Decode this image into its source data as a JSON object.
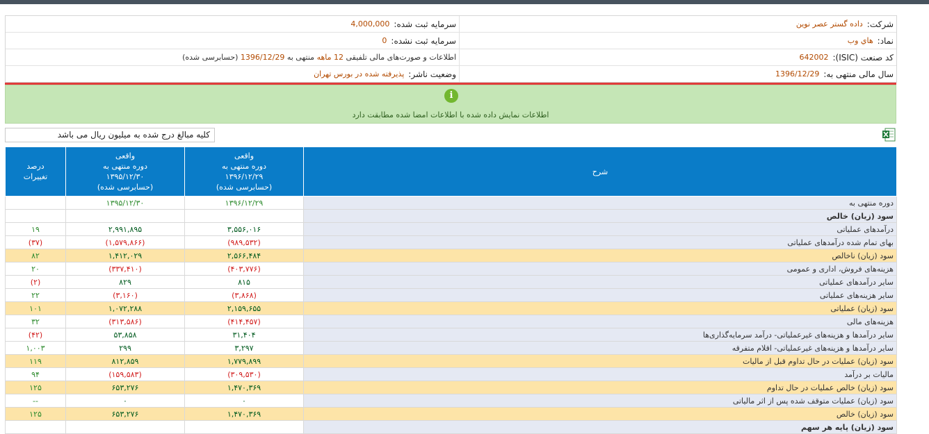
{
  "company": {
    "company_label": "شرکت:",
    "company_value": "داده گستر عصر نوین",
    "capital_reg_label": "سرمایه ثبت شده:",
    "capital_reg_value": "4,000,000",
    "symbol_label": "نماد:",
    "symbol_value": "هاي وب",
    "capital_unreg_label": "سرمایه ثبت نشده:",
    "capital_unreg_value": "0",
    "isic_label": "کد صنعت (ISIC):",
    "isic_value": "642002",
    "report_prefix": "اطلاعات و صورت‌های مالی تلفیقی",
    "report_period": "12 ماهه",
    "report_mid": "منتهی به",
    "report_date": "1396/12/29",
    "report_suffix": "(حسابرسی شده)",
    "fiscal_label": "سال مالی منتهی به:",
    "fiscal_value": "1396/12/29",
    "publisher_label": "وضعیت ناشر:",
    "publisher_value": "پذیرفته شده در بورس تهران"
  },
  "notice": {
    "icon": "info-icon",
    "text": "اطلاعات نمایش داده شده با اطلاعات امضا شده مطابقت دارد"
  },
  "unit_note": "کلیه مبالغ درج شده به میلیون ریال می باشد",
  "table": {
    "headers": {
      "desc": "شرح",
      "col1_l1": "واقعی",
      "col1_l2": "دوره منتهی به",
      "col1_l3": "۱۳۹۶/۱۲/۲۹",
      "col1_l4": "(حسابرسی شده)",
      "col2_l1": "واقعی",
      "col2_l2": "دوره منتهی به",
      "col2_l3": "۱۳۹۵/۱۲/۳۰",
      "col2_l4": "(حسابرسی شده)",
      "pct_l1": "درصد",
      "pct_l2": "تغییرات"
    },
    "rows": [
      {
        "desc": "دوره منتهی به",
        "v1": "۱۳۹۶/۱۲/۲۹",
        "v2": "۱۳۹۵/۱۲/۳۰",
        "pct": ""
      },
      {
        "desc": "سود (زیان) خالص",
        "v1": "",
        "v2": "",
        "pct": ""
      },
      {
        "desc": "درآمدهای عملیاتی",
        "v1": "۳,۵۵۶,۰۱۶",
        "v2": "۲,۹۹۱,۸۹۵",
        "pct": "۱۹"
      },
      {
        "desc": "بهای تمام شده درآمدهای عملیاتی",
        "v1": "(۹۸۹,۵۳۲)",
        "v2": "(۱,۵۷۹,۸۶۶)",
        "pct": "(۳۷)"
      },
      {
        "desc": "سود (زیان) ناخالص",
        "v1": "۲,۵۶۶,۴۸۴",
        "v2": "۱,۴۱۲,۰۲۹",
        "pct": "۸۲"
      },
      {
        "desc": "هزینه‌های فروش، اداری و عمومی",
        "v1": "(۴۰۳,۷۷۶)",
        "v2": "(۳۳۷,۴۱۰)",
        "pct": "۲۰"
      },
      {
        "desc": "سایر درآمدهای عملیاتی",
        "v1": "۸۱۵",
        "v2": "۸۲۹",
        "pct": "(۲)"
      },
      {
        "desc": "سایر هزینه‌های عملیاتی",
        "v1": "(۳,۸۶۸)",
        "v2": "(۳,۱۶۰)",
        "pct": "۲۲"
      },
      {
        "desc": "سود (زیان) عملیاتی",
        "v1": "۲,۱۵۹,۶۵۵",
        "v2": "۱,۰۷۲,۲۸۸",
        "pct": "۱۰۱"
      },
      {
        "desc": "هزینه‌های مالی",
        "v1": "(۴۱۴,۴۵۷)",
        "v2": "(۳۱۳,۵۸۶)",
        "pct": "۳۲"
      },
      {
        "desc": "سایر درآمدها و هزینه‌های غیرعملیاتی- درآمد سرمایه‌گذاری‌ها",
        "v1": "۳۱,۴۰۴",
        "v2": "۵۳,۸۵۸",
        "pct": "(۴۲)"
      },
      {
        "desc": "سایر درآمدها و هزینه‌های غیرعملیاتی- اقلام متفرقه",
        "v1": "۳,۲۹۷",
        "v2": "۲۹۹",
        "pct": "۱,۰۰۳"
      },
      {
        "desc": "سود (زیان) عملیات در حال تداوم قبل از مالیات",
        "v1": "۱,۷۷۹,۸۹۹",
        "v2": "۸۱۲,۸۵۹",
        "pct": "۱۱۹"
      },
      {
        "desc": "مالیات بر درآمد",
        "v1": "(۳۰۹,۵۳۰)",
        "v2": "(۱۵۹,۵۸۳)",
        "pct": "۹۴"
      },
      {
        "desc": "سود (زیان) خالص عملیات در حال تداوم",
        "v1": "۱,۴۷۰,۳۶۹",
        "v2": "۶۵۳,۲۷۶",
        "pct": "۱۲۵"
      },
      {
        "desc": "سود (زیان) عملیات متوقف شده پس از اثر مالیاتی",
        "v1": "۰",
        "v2": "۰",
        "pct": "--"
      },
      {
        "desc": "سود (زیان) خالص",
        "v1": "۱,۴۷۰,۳۶۹",
        "v2": "۶۵۳,۲۷۶",
        "pct": "۱۲۵"
      },
      {
        "desc": "سود (زیان) پایه هر سهم",
        "v1": "",
        "v2": "",
        "pct": ""
      }
    ]
  },
  "colors": {
    "header_bg": "#0a7cc8",
    "highlight_row": "#fde4a8",
    "desc_bg": "#e5e9f3",
    "negative": "#d11c1c",
    "positive": "#005a1e",
    "notice_bg": "#c5e6b6"
  }
}
